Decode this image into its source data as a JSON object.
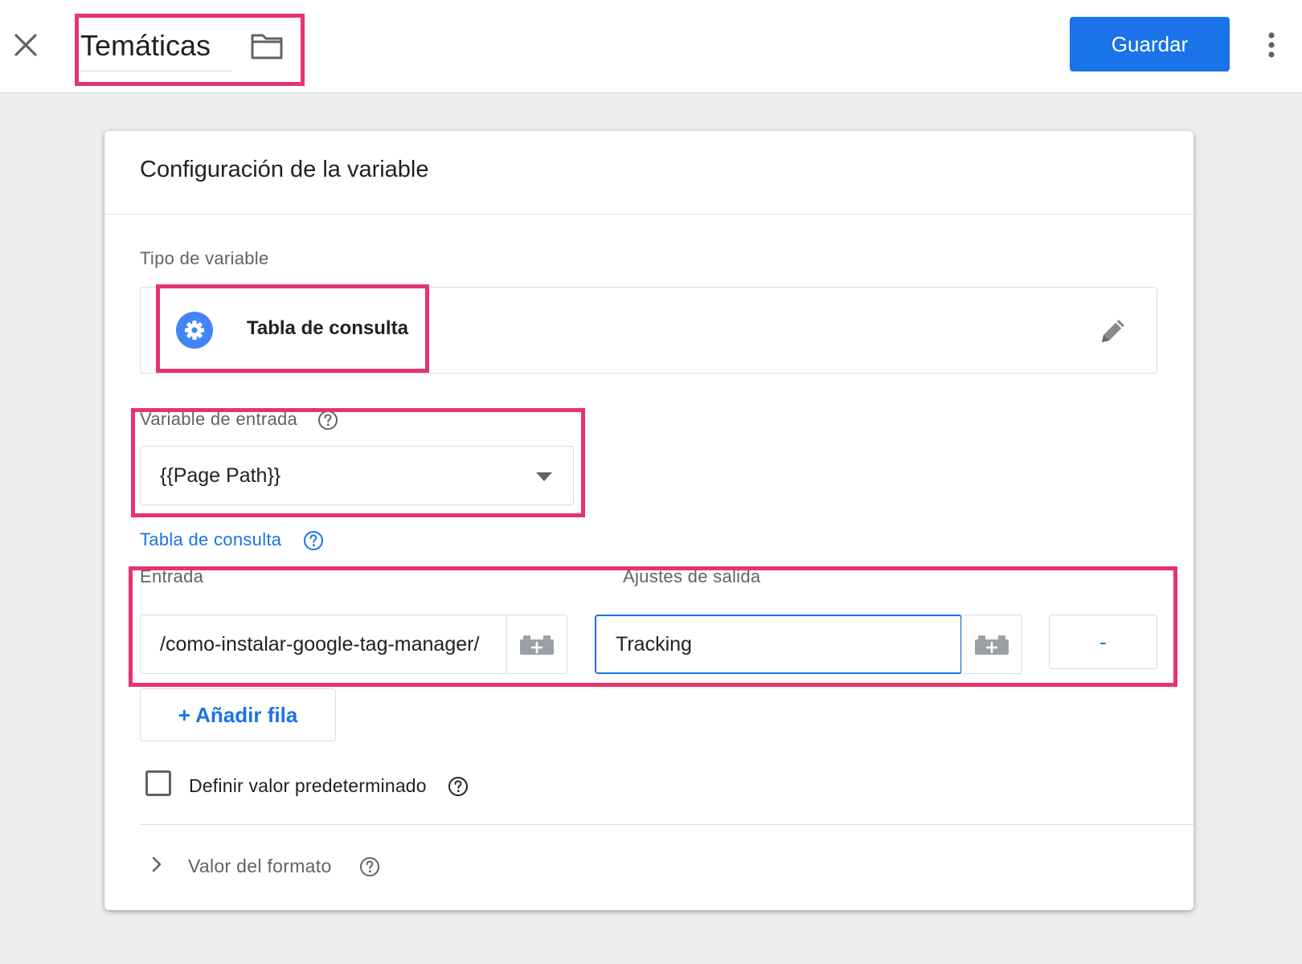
{
  "header": {
    "title": "Temáticas",
    "save_label": "Guardar",
    "icons": {
      "close": "close-icon",
      "folder": "folder-icon",
      "more": "more-vert-icon"
    }
  },
  "card": {
    "title": "Configuración de la variable",
    "variable_type": {
      "label": "Tipo de variable",
      "name": "Tabla de consulta",
      "icon": "gear-icon"
    },
    "input_variable": {
      "label": "Variable de entrada",
      "value": "{{Page Path}}"
    },
    "lookup_table": {
      "label": "Tabla de consulta",
      "columns": {
        "input": "Entrada",
        "output": "Ajustes de salida"
      },
      "rows": [
        {
          "input": "/como-instalar-google-tag-manager/",
          "output": "Tracking"
        }
      ],
      "remove_label": "-",
      "add_row_label": "+ Añadir fila"
    },
    "default_value": {
      "label": "Definir valor predeterminado",
      "checked": false
    },
    "format_value": {
      "label": "Valor del formato"
    }
  },
  "colors": {
    "accent": "#1a73e8",
    "highlight": "#e8336c",
    "background": "#eeeeee"
  }
}
